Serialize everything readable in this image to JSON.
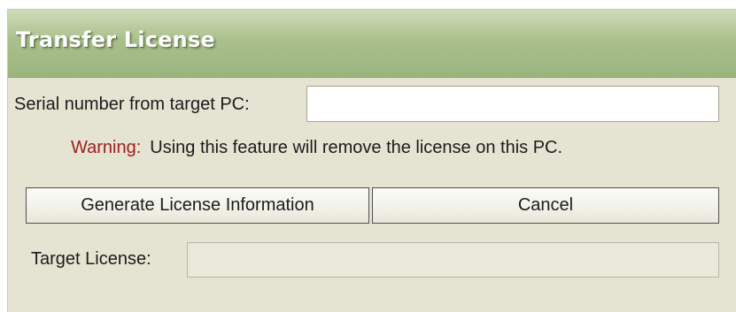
{
  "dialog": {
    "title": "Transfer License"
  },
  "serial": {
    "label": "Serial number from target PC:",
    "value": "",
    "placeholder": ""
  },
  "warning": {
    "prefix": "Warning:",
    "message": "Using this feature will remove the license on this PC."
  },
  "buttons": {
    "generate_label": "Generate License Information",
    "cancel_label": "Cancel"
  },
  "target": {
    "label": "Target License:",
    "value": ""
  },
  "colors": {
    "title_bar": "#aac08c",
    "dialog_background": "#e5e4d3",
    "warning_prefix": "#a11d1d"
  }
}
